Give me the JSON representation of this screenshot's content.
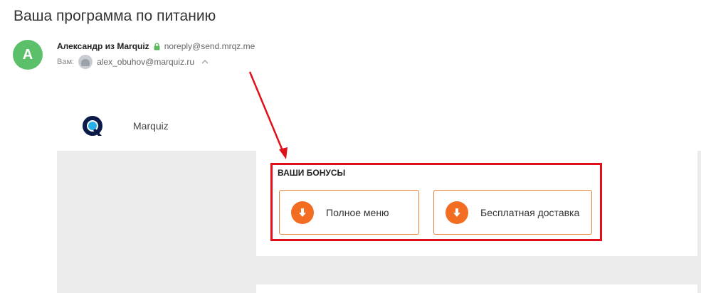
{
  "email": {
    "subject": "Ваша программа по питанию",
    "avatar_letter": "А",
    "sender_name": "Александр из Marquiz",
    "sender_email": "noreply@send.mrqz.me",
    "to_label": "Вам:",
    "recipient_email": "alex_obuhov@marquiz.ru"
  },
  "brand": {
    "name": "Marquiz"
  },
  "bonuses": {
    "title": "ВАШИ БОНУСЫ",
    "items": [
      {
        "label": "Полное меню",
        "icon": "download-icon"
      },
      {
        "label": "Бесплатная доставка",
        "icon": "download-icon"
      }
    ]
  },
  "colors": {
    "avatar_green": "#5cc06a",
    "accent_orange": "#f26c22",
    "annotation_red": "#e01019",
    "panel_gray": "#ebebeb"
  }
}
